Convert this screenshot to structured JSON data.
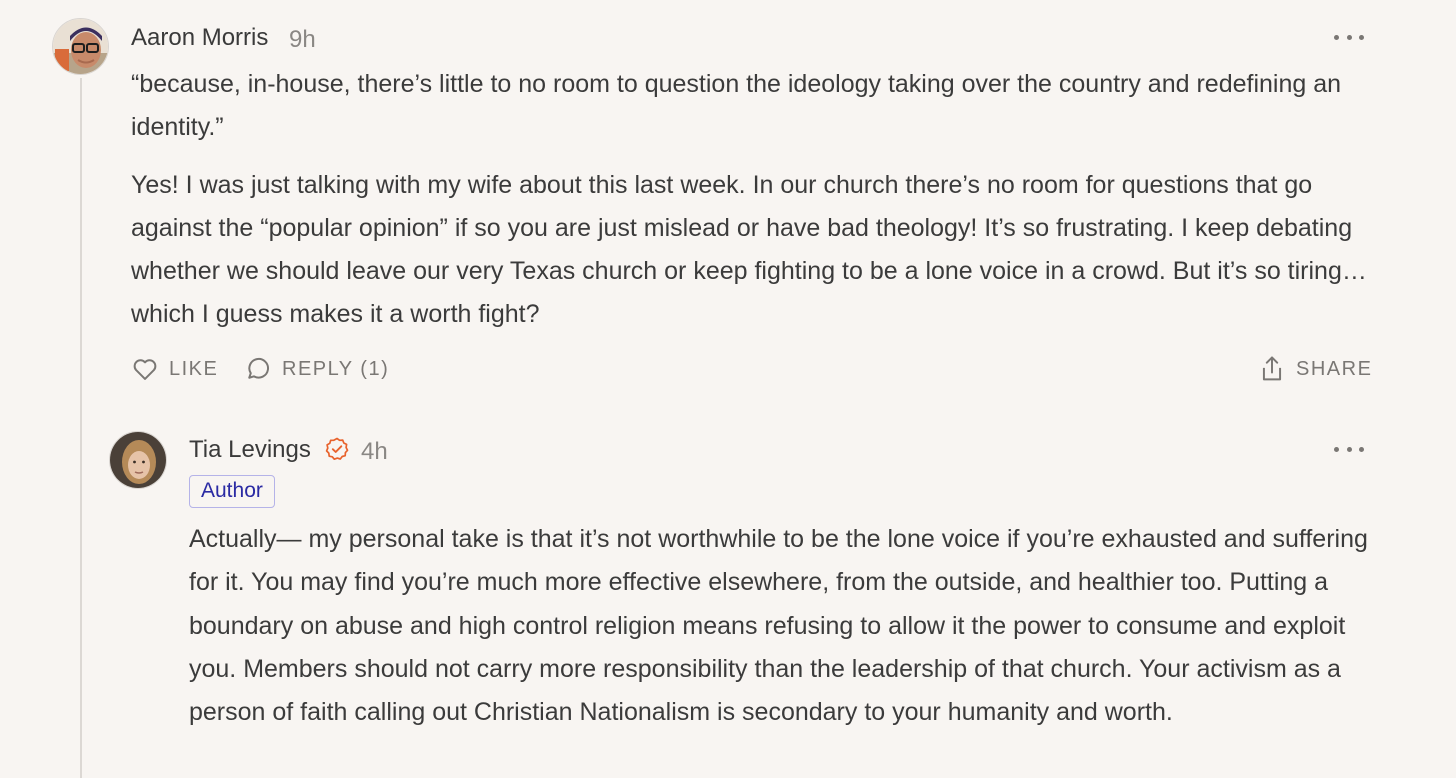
{
  "comment1": {
    "author": "Aaron Morris",
    "time": "9h",
    "quote": "“because, in-house, there’s little to no room to question the ideology taking over the country and redefining an identity.”",
    "paragraph": "Yes! I was just talking with my wife about this last week. In our church there’s no room for questions that go against the “popular opinion” if so you are just mislead or have bad theology! It’s so frustrating. I keep debating whether we should leave our very Texas church or keep fighting to be a lone voice in a crowd. But it’s so tiring…which I guess makes it a worth fight?",
    "actions": {
      "like": "LIKE",
      "reply": "REPLY (1)",
      "share": "SHARE"
    }
  },
  "reply": {
    "author": "Tia Levings",
    "time": "4h",
    "badge": "Author",
    "text": "Actually— my personal take is that it’s not worthwhile to be the lone voice if you’re exhausted and suffering for it. You may find you’re much more effective elsewhere, from the outside, and healthier too. Putting a boundary on abuse and high control religion means refusing to allow it the power to consume and exploit you. Members should not carry more responsibility than the leadership of that church. Your activism as a person of faith calling out Christian Nationalism is secondary to your humanity and worth."
  },
  "colors": {
    "background": "#f8f5f2",
    "verified": "#e8622c",
    "author_badge": "#2a2aa3"
  }
}
